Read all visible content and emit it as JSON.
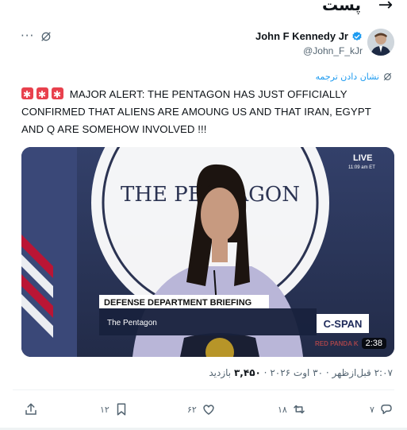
{
  "topbar": {
    "title": "پست",
    "back_icon": "arrow-right-icon"
  },
  "author": {
    "name": "John F Kennedy Jr",
    "handle": "@John_F_kJr",
    "verified": true,
    "verified_color": "#1d9bf0"
  },
  "translate": {
    "label": "نشان دادن ترجمه"
  },
  "tweet": {
    "text": "MAJOR ALERT: THE PENTAGON HAS JUST OFFICIALLY CONFIRMED THAT ALIENS ARE AMOUNG US AND THAT IRAN, EGYPT AND Q ARE SOMEHOW INVOLVED !!!"
  },
  "media": {
    "backdrop_text": "THE PENTAGON",
    "live_label": "LIVE",
    "live_time": "11:09 am ET",
    "lower_third_title": "DEFENSE DEPARTMENT BRIEFING",
    "lower_third_subtitle": "The Pentagon",
    "network": "C-SPAN",
    "watermark": "RED PANDA K",
    "duration": "2:38"
  },
  "meta": {
    "time": "۲:۰۷ قبل‌ازظهر",
    "date": "۳۰ اوت ۲۰۲۶",
    "views": "۳,۴۵۰",
    "views_label": "بازدید"
  },
  "actions": {
    "replies": "۷",
    "reposts": "۱۸",
    "likes": "۶۲",
    "bookmarks": "۱۲"
  },
  "colors": {
    "accent": "#1d9bf0",
    "text": "#0f1419",
    "muted": "#536471"
  }
}
